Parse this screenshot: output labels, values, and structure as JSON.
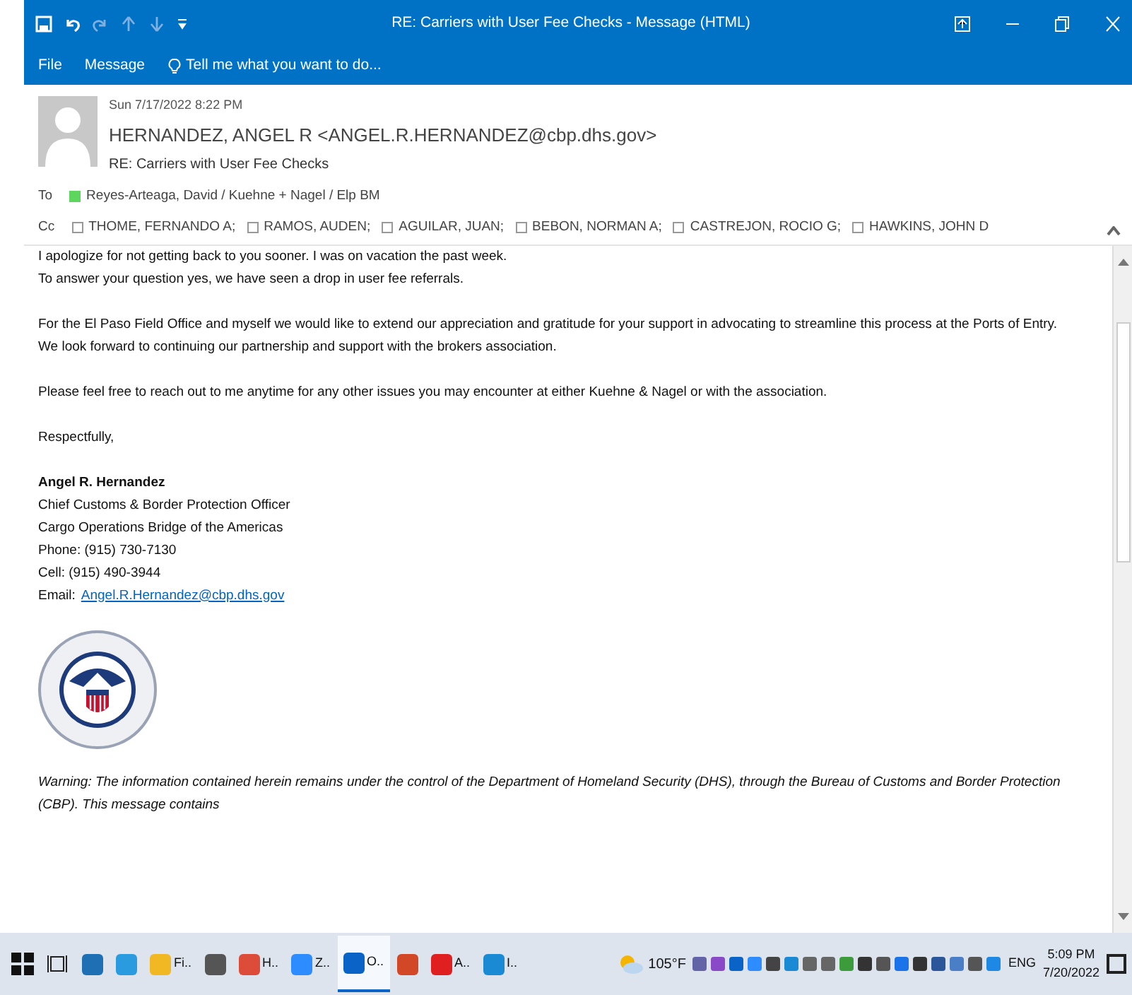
{
  "window": {
    "title": "RE: Carriers with User Fee Checks - Message (HTML)"
  },
  "ribbon": {
    "tabs": [
      {
        "label": "File"
      },
      {
        "label": "Message"
      }
    ],
    "tell_me": "Tell me what you want to do..."
  },
  "header": {
    "date": "Sun 7/17/2022 8:22 PM",
    "from": "HERNANDEZ, ANGEL R <ANGEL.R.HERNANDEZ@cbp.dhs.gov>",
    "subject": "RE: Carriers with User Fee Checks",
    "to_label": "To",
    "to": [
      {
        "name": "Reyes-Arteaga, David / Kuehne + Nagel / Elp BM",
        "available": true
      }
    ],
    "cc_label": "Cc",
    "cc": [
      {
        "name": "THOME, FERNANDO A;",
        "available": false
      },
      {
        "name": "RAMOS, AUDEN;",
        "available": false
      },
      {
        "name": "AGUILAR, JUAN;",
        "available": false
      },
      {
        "name": "BEBON, NORMAN A;",
        "available": false
      },
      {
        "name": "CASTREJON, ROCIO G;",
        "available": false
      },
      {
        "name": "HAWKINS, JOHN D",
        "available": false
      }
    ]
  },
  "body": {
    "paragraphs": [
      [
        "I apologize for not getting back to you sooner. I was on vacation the past week.",
        "To answer your question yes, we have seen a drop in user fee referrals."
      ],
      [
        "For the El Paso Field Office and myself we would like to extend our appreciation and gratitude for your support in advocating to streamline this process at the Ports of Entry.",
        "We look forward to continuing our partnership and support with the brokers association."
      ],
      [
        "Please feel free to reach out to me anytime for any other issues you may encounter at either Kuehne & Nagel or with the association."
      ],
      [
        "Respectfully,"
      ]
    ],
    "signature": {
      "name": "Angel R. Hernandez",
      "lines": [
        "Chief Customs & Border Protection Officer",
        "Cargo Operations Bridge of the Americas",
        "Phone: (915) 730-7130",
        "Cell: (915) 490-3944"
      ],
      "email_label": "Email:",
      "email": "Angel.R.Hernandez@cbp.dhs.gov"
    },
    "warning": "Warning: The information contained herein remains under the control of the Department of Homeland Security (DHS), through the Bureau of Customs and Border Protection (CBP).  This message contains"
  },
  "taskbar": {
    "apps": [
      {
        "kind": "start",
        "selected": false
      },
      {
        "kind": "taskview",
        "selected": false
      },
      {
        "kind": "app",
        "color": "#1f6fb5",
        "selected": false
      },
      {
        "kind": "app",
        "color": "#2b9be0",
        "selected": false
      },
      {
        "kind": "app",
        "color": "#f2b824",
        "label": "Fi..",
        "selected": false
      },
      {
        "kind": "app",
        "color": "#555555",
        "selected": false
      },
      {
        "kind": "app",
        "color": "#dd4b39",
        "label": "H..",
        "selected": false
      },
      {
        "kind": "app",
        "color": "#2d8cff",
        "label": "Z..",
        "selected": false
      },
      {
        "kind": "app",
        "color": "#0a64c8",
        "label": "O..",
        "selected": true
      },
      {
        "kind": "app",
        "color": "#d24726",
        "selected": false
      },
      {
        "kind": "app",
        "color": "#e02020",
        "label": "A..",
        "selected": false
      },
      {
        "kind": "app",
        "color": "#1a8ad4",
        "label": "I..",
        "selected": false
      }
    ],
    "weather": "105°F",
    "language": "ENG",
    "time": "5:09 PM",
    "date": "7/20/2022"
  }
}
